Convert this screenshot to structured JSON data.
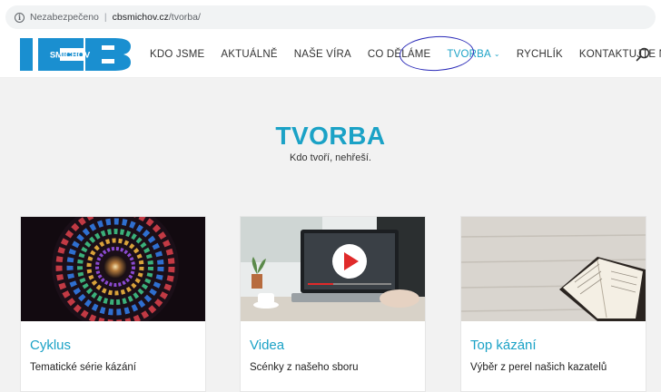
{
  "browser": {
    "security_label": "Nezabezpečeno",
    "separator": "|",
    "url_host": "cbsmichov.cz",
    "url_path": "/tvorba/"
  },
  "header": {
    "logo_text": "SMÍCHOV",
    "nav": [
      {
        "label": "KDO JSME"
      },
      {
        "label": "AKTUÁLNĚ"
      },
      {
        "label": "NAŠE VÍRA"
      },
      {
        "label": "CO DĚLÁME"
      },
      {
        "label": "TVORBA",
        "active": true
      },
      {
        "label": "RYCHLÍK"
      },
      {
        "label": "KONTAKTUJTE NÁS"
      }
    ],
    "dropdown_glyph": "⌄"
  },
  "hero": {
    "title": "TVORBA",
    "subtitle": "Kdo tvoří, nehřeší."
  },
  "cards": [
    {
      "title": "Cyklus",
      "description": "Tematické série kázání"
    },
    {
      "title": "Videa",
      "description": "Scénky z našeho sboru"
    },
    {
      "title": "Top kázání",
      "description": "Výběr z perel našich kazatelů"
    }
  ],
  "colors": {
    "accent": "#1ba2c6",
    "logo_blue": "#1a8fd0",
    "annotation": "#2a2ab8"
  }
}
